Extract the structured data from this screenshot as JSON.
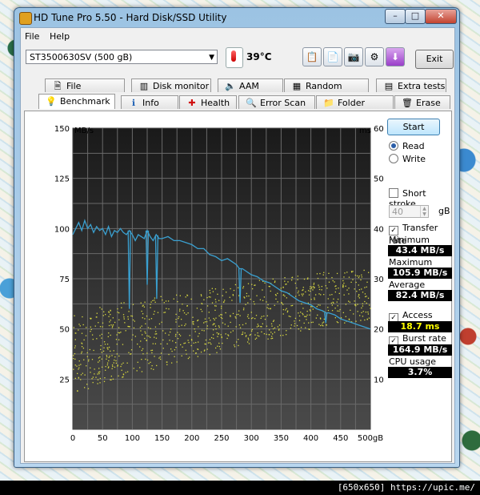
{
  "window": {
    "title": "HD Tune Pro 5.50 - Hard Disk/SSD Utility",
    "controls": [
      "–",
      "□",
      "✕"
    ]
  },
  "menu": [
    "File",
    "Help"
  ],
  "toolbar": {
    "drive": "ST3500630SV (500 gB)",
    "temperature": "39",
    "temperature_unit": "°C",
    "exit_label": "Exit",
    "buttons": [
      {
        "icon": "copy-text-icon",
        "glyph": "📋"
      },
      {
        "icon": "copy-info-icon",
        "glyph": "📄"
      },
      {
        "icon": "camera-icon",
        "glyph": "📷"
      },
      {
        "icon": "options-icon",
        "glyph": "⚙"
      },
      {
        "icon": "save-icon",
        "glyph": "⬇"
      }
    ]
  },
  "tabs_top": [
    {
      "label": "File Benchmark",
      "icon": "file-benchmark-icon",
      "glyph": "🗎"
    },
    {
      "label": "Disk monitor",
      "icon": "disk-monitor-icon",
      "glyph": "▥"
    },
    {
      "label": "AAM",
      "icon": "speaker-icon",
      "glyph": "🔈"
    },
    {
      "label": "Random Access",
      "icon": "random-access-icon",
      "glyph": "▦"
    },
    {
      "label": "Extra tests",
      "icon": "extra-tests-icon",
      "glyph": "▤"
    }
  ],
  "tabs_bottom": [
    {
      "label": "Benchmark",
      "icon": "lightbulb-icon",
      "glyph": "💡",
      "active": true
    },
    {
      "label": "Info",
      "icon": "info-icon",
      "glyph": "ℹ"
    },
    {
      "label": "Health",
      "icon": "health-cross-icon",
      "glyph": "✚"
    },
    {
      "label": "Error Scan",
      "icon": "magnifier-icon",
      "glyph": "🔍"
    },
    {
      "label": "Folder Usage",
      "icon": "folder-icon",
      "glyph": "📁"
    },
    {
      "label": "Erase",
      "icon": "trash-icon",
      "glyph": "🗑"
    }
  ],
  "side": {
    "start_label": "Start",
    "read_label": "Read",
    "write_label": "Write",
    "short_stroke_label": "Short stroke",
    "short_stroke_value": "40",
    "short_stroke_unit": "gB",
    "transfer_rate_label": "Transfer rate",
    "minimum_label": "Minimum",
    "minimum_value": "43.4 MB/s",
    "maximum_label": "Maximum",
    "maximum_value": "105.9 MB/s",
    "average_label": "Average",
    "average_value": "82.4 MB/s",
    "access_time_label": "Access time",
    "access_time_value": "18.7 ms",
    "burst_rate_label": "Burst rate",
    "burst_rate_value": "164.9 MB/s",
    "cpu_usage_label": "CPU usage",
    "cpu_usage_value": "3.7%"
  },
  "footer": "[650x650] https://upic.me/",
  "chart_data": {
    "type": "line",
    "ylabel_left": "MB/s",
    "ylabel_right": "ms",
    "ylim_left": [
      0,
      150
    ],
    "ylim_right": [
      0,
      60
    ],
    "xlim": [
      0,
      500
    ],
    "x_ticks": [
      "0",
      "50",
      "100",
      "150",
      "200",
      "250",
      "300",
      "350",
      "400",
      "450",
      "500gB"
    ],
    "y_ticks_left": [
      "150",
      "125",
      "100",
      "75",
      "50",
      "25"
    ],
    "y_ticks_right": [
      "60",
      "50",
      "40",
      "30",
      "20",
      "10"
    ],
    "grid": true,
    "colors": {
      "transfer": "#3aa0d0",
      "access": "#d8d840",
      "background": "#1e1e1e",
      "grid": "#6a6a6a"
    },
    "series": [
      {
        "axis": "left",
        "x": [
          0,
          5,
          10,
          15,
          20,
          25,
          30,
          35,
          40,
          45,
          50,
          55,
          60,
          65,
          70,
          75,
          80,
          85,
          90,
          95,
          100,
          105,
          110,
          115,
          120,
          125,
          130,
          135,
          140,
          145,
          150,
          160,
          170,
          180,
          190,
          200,
          210,
          220,
          230,
          240,
          250,
          260,
          270,
          275,
          280,
          285,
          290,
          300,
          310,
          320,
          330,
          340,
          350,
          360,
          370,
          380,
          390,
          400,
          410,
          420,
          425,
          430,
          440,
          450,
          460,
          470,
          480,
          490,
          500
        ],
        "values": [
          97,
          100,
          103,
          99,
          104,
          100,
          102,
          98,
          101,
          99,
          100,
          97,
          101,
          96,
          99,
          98,
          100,
          98,
          97,
          99,
          97,
          94,
          97,
          96,
          95,
          99,
          96,
          94,
          97,
          95,
          95,
          96,
          94,
          94,
          93,
          92,
          90,
          90,
          87,
          86,
          84,
          85,
          83,
          82,
          80,
          80,
          79,
          77,
          76,
          74,
          73,
          71,
          69,
          68,
          66,
          64,
          63,
          62,
          60,
          59,
          58,
          58,
          57,
          55,
          54,
          53,
          52,
          51,
          50
        ]
      },
      {
        "axis": "left",
        "type": "dips",
        "x": [
          95,
          125,
          141,
          281,
          425
        ],
        "values": [
          60,
          72,
          65,
          63,
          53
        ]
      },
      {
        "axis": "right",
        "type": "scatter",
        "trend_x": [
          0,
          50,
          100,
          150,
          200,
          250,
          300,
          350,
          400,
          450,
          500
        ],
        "trend_values": [
          15,
          17,
          18.5,
          19.5,
          21,
          22,
          23.5,
          24.5,
          25.5,
          26.5,
          27
        ]
      }
    ]
  }
}
